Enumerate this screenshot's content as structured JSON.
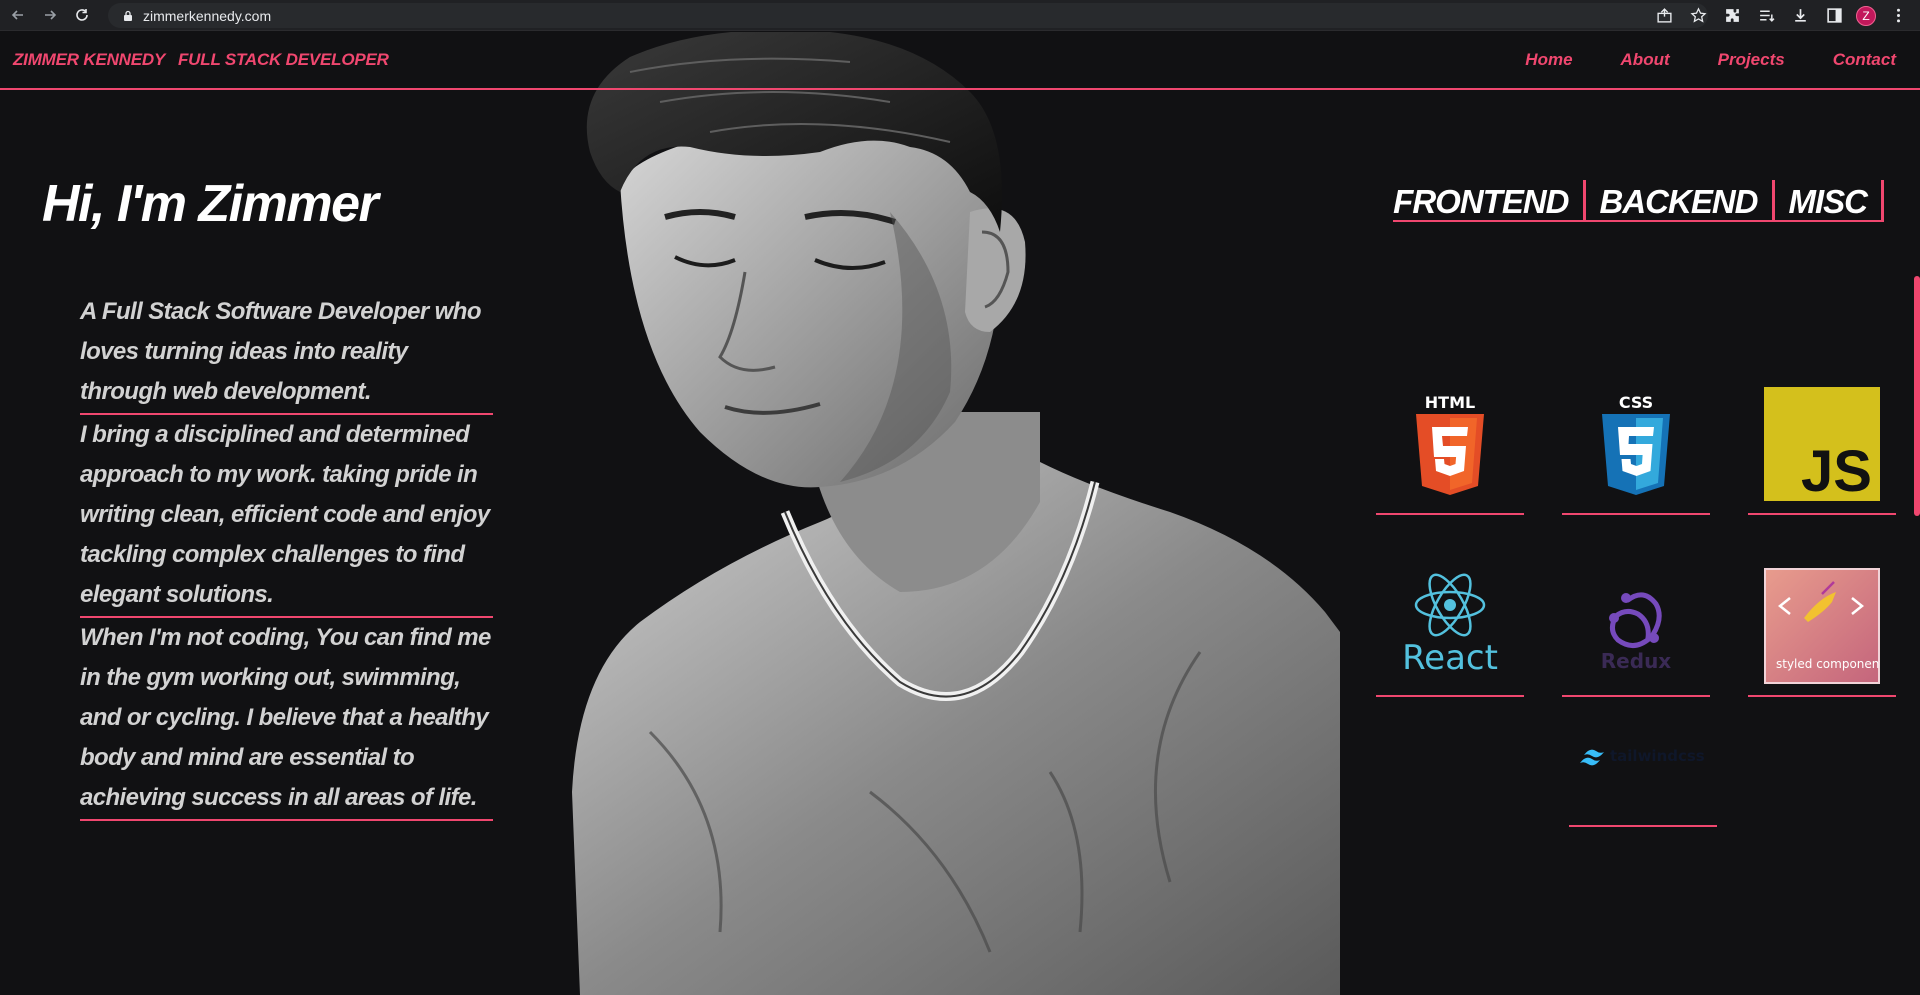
{
  "browser": {
    "url": "zimmerkennedy.com",
    "profile_initial": "Z",
    "icons": [
      "back-icon",
      "forward-icon",
      "reload-icon",
      "lock-icon",
      "share-icon",
      "star-icon",
      "extensions-icon",
      "reading-list-icon",
      "download-icon",
      "side-panel-icon",
      "menu-icon"
    ]
  },
  "nav": {
    "name": "ZIMMER KENNEDY",
    "role": "FULL STACK DEVELOPER",
    "links": [
      "Home",
      "About",
      "Projects",
      "Contact"
    ]
  },
  "hero": {
    "headline": "Hi, I'm Zimmer",
    "paragraphs": [
      "A Full Stack Software Developer who loves turning ideas into reality through web development.",
      "I bring a disciplined and determined approach to my work. taking pride in writing clean, efficient code and enjoy tackling complex challenges to find elegant solutions.",
      "When I'm not coding, You can find me in the gym working out, swimming, and or cycling. I believe that a healthy body and mind are essential to achieving success in all areas of life."
    ]
  },
  "skills": {
    "tabs": [
      "FRONTEND",
      "BACKEND",
      "MISC"
    ],
    "items": [
      {
        "label": "HTML",
        "icon": "html5-icon"
      },
      {
        "label": "CSS",
        "icon": "css3-icon"
      },
      {
        "label": "JS",
        "icon": "javascript-icon"
      },
      {
        "label": "React",
        "icon": "react-icon"
      },
      {
        "label": "Redux",
        "icon": "redux-icon"
      },
      {
        "label": "styled components",
        "icon": "styled-components-icon"
      },
      {
        "label": "tailwindcss",
        "icon": "tailwind-icon"
      }
    ]
  },
  "colors": {
    "accent": "#f0476f",
    "background": "#111113",
    "text": "#ffffff",
    "body_text": "#d2d2d2"
  }
}
